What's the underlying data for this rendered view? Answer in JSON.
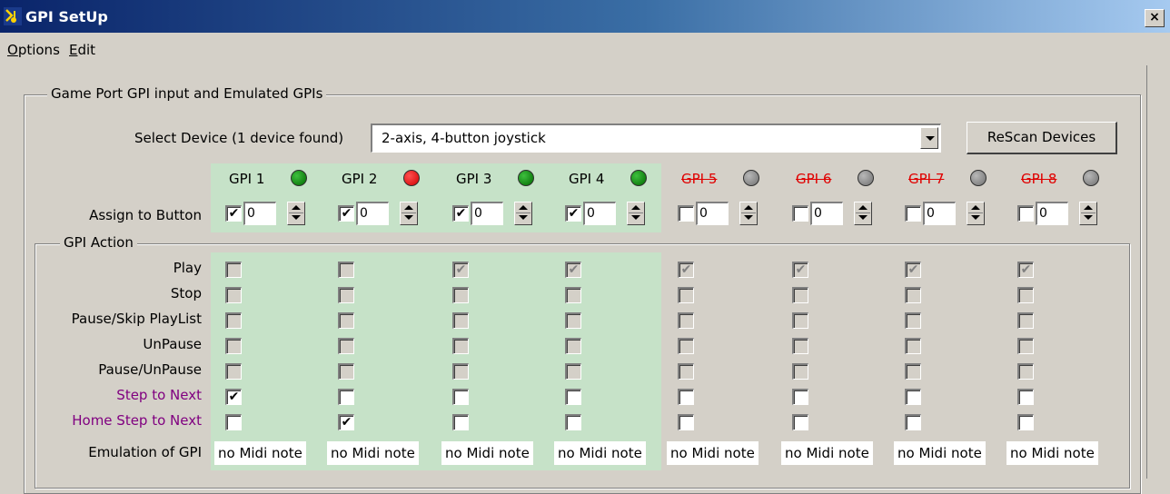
{
  "window": {
    "title": "GPI SetUp",
    "close_label": "×"
  },
  "menu": {
    "options": "Options",
    "edit": "Edit"
  },
  "group": {
    "title": "Game Port GPI input and Emulated GPIs",
    "select_label": "Select Device (1 device found)",
    "device_value": "2-axis, 4-button joystick",
    "rescan_label": "ReScan Devices",
    "assign_label": "Assign to Button",
    "action_title": "GPI Action",
    "emulation_label": "Emulation of GPI"
  },
  "gpis": [
    {
      "label": "GPI 1",
      "enabled": true,
      "led": "green",
      "assigned": true,
      "button": "0",
      "midi": "no Midi note"
    },
    {
      "label": "GPI 2",
      "enabled": true,
      "led": "red",
      "assigned": true,
      "button": "0",
      "midi": "no Midi note"
    },
    {
      "label": "GPI 3",
      "enabled": true,
      "led": "green",
      "assigned": true,
      "button": "0",
      "midi": "no Midi note"
    },
    {
      "label": "GPI 4",
      "enabled": true,
      "led": "green",
      "assigned": true,
      "button": "0",
      "midi": "no Midi note"
    },
    {
      "label": "GPI 5",
      "enabled": false,
      "led": "gray",
      "assigned": false,
      "button": "0",
      "midi": "no Midi note"
    },
    {
      "label": "GPI 6",
      "enabled": false,
      "led": "gray",
      "assigned": false,
      "button": "0",
      "midi": "no Midi note"
    },
    {
      "label": "GPI 7",
      "enabled": false,
      "led": "gray",
      "assigned": false,
      "button": "0",
      "midi": "no Midi note"
    },
    {
      "label": "GPI 8",
      "enabled": false,
      "led": "gray",
      "assigned": false,
      "button": "0",
      "midi": "no Midi note"
    }
  ],
  "actions": [
    {
      "label": "Play",
      "highlight": false,
      "checked": [
        false,
        false,
        true,
        true,
        true,
        true,
        true,
        true
      ],
      "disabled": true
    },
    {
      "label": "Stop",
      "highlight": false,
      "checked": [
        false,
        false,
        false,
        false,
        false,
        false,
        false,
        false
      ],
      "disabled": true
    },
    {
      "label": "Pause/Skip PlayList",
      "highlight": false,
      "checked": [
        false,
        false,
        false,
        false,
        false,
        false,
        false,
        false
      ],
      "disabled": true
    },
    {
      "label": "UnPause",
      "highlight": false,
      "checked": [
        false,
        false,
        false,
        false,
        false,
        false,
        false,
        false
      ],
      "disabled": true
    },
    {
      "label": "Pause/UnPause",
      "highlight": false,
      "checked": [
        false,
        false,
        false,
        false,
        false,
        false,
        false,
        false
      ],
      "disabled": true
    },
    {
      "label": "Step to Next",
      "highlight": true,
      "checked": [
        true,
        false,
        false,
        false,
        false,
        false,
        false,
        false
      ],
      "disabled": false
    },
    {
      "label": "Home Step to Next",
      "highlight": true,
      "checked": [
        false,
        true,
        false,
        false,
        false,
        false,
        false,
        false
      ],
      "disabled": false
    }
  ],
  "colors": {
    "enabled_band": "#c6e2c8",
    "disabled_label": "#e00000",
    "highlight_label": "#800080"
  }
}
